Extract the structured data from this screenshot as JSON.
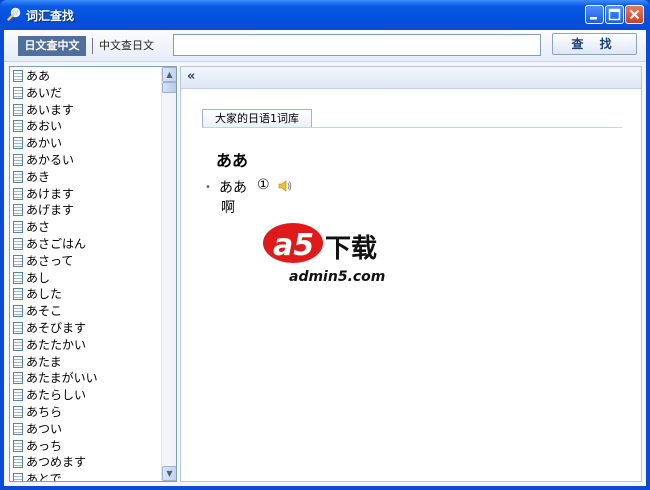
{
  "window": {
    "title": "词汇查找"
  },
  "toolbar": {
    "mode_active": "日文查中文",
    "mode_other": "中文查日文",
    "search_value": "",
    "search_button": "查 找"
  },
  "word_list": [
    "ああ",
    "あいだ",
    "あいます",
    "あおい",
    "あかい",
    "あかるい",
    "あき",
    "あけます",
    "あげます",
    "あさ",
    "あさごはん",
    "あさって",
    "あし",
    "あした",
    "あそこ",
    "あそびます",
    "あたたかい",
    "あたま",
    "あたまがいい",
    "あたらしい",
    "あちら",
    "あつい",
    "あっち",
    "あつめます",
    "あとで"
  ],
  "content": {
    "collapse_label": "«",
    "tab_label": "大家的日语1词库",
    "entry_word": "ああ",
    "sense_word": "ああ",
    "sense_accent": "①",
    "sense_meaning": "啊"
  },
  "watermark": {
    "logo_mark": "a5",
    "logo_word": "下载",
    "logo_site": "admin5.com"
  },
  "colors": {
    "titlebar": "#0a4cd6",
    "active_mode": "#4f6f9c",
    "logo_red": "#e01a1a"
  }
}
